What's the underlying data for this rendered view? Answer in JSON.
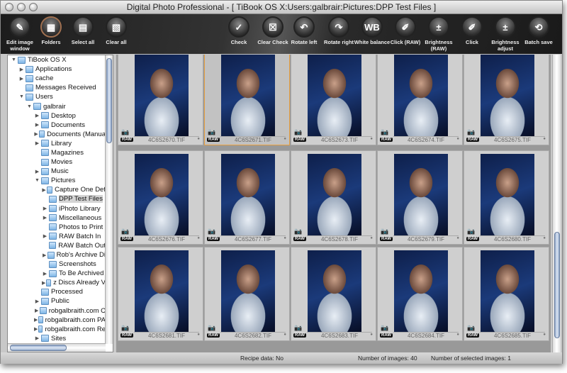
{
  "window": {
    "title": "Digital Photo Professional - [ TiBook OS X:Users:galbrair:Pictures:DPP Test Files ]"
  },
  "toolbar": [
    {
      "label": "Edit image window",
      "icon": "edit-image-icon",
      "glyph": "✎"
    },
    {
      "label": "Folders",
      "icon": "folders-icon",
      "glyph": "▦",
      "active": true
    },
    {
      "label": "Select all",
      "icon": "select-all-icon",
      "glyph": "▤"
    },
    {
      "label": "Clear all",
      "icon": "clear-all-icon",
      "glyph": "▧"
    },
    {
      "label": "Check",
      "icon": "check-icon",
      "glyph": "✓"
    },
    {
      "label": "Clear Check",
      "icon": "clear-check-icon",
      "glyph": "☒"
    },
    {
      "label": "Rotate left",
      "icon": "rotate-left-icon",
      "glyph": "↶"
    },
    {
      "label": "Rotate right",
      "icon": "rotate-right-icon",
      "glyph": "↷"
    },
    {
      "label": "White balance",
      "icon": "white-balance-icon",
      "glyph": "WB"
    },
    {
      "label": "Click (RAW)",
      "icon": "eyedropper-icon",
      "glyph": "✐"
    },
    {
      "label": "Brightness (RAW)",
      "icon": "brightness-icon",
      "glyph": "±"
    },
    {
      "label": "Click",
      "icon": "eyedropper-icon",
      "glyph": "✐"
    },
    {
      "label": "Brightness adjust",
      "icon": "brightness-adjust-icon",
      "glyph": "±"
    },
    {
      "label": "Batch save",
      "icon": "batch-save-icon",
      "glyph": "⟲"
    }
  ],
  "tree": [
    {
      "label": "TiBook OS X",
      "depth": 0,
      "exp": "open"
    },
    {
      "label": "Applications",
      "depth": 1,
      "exp": "closed"
    },
    {
      "label": "cache",
      "depth": 1,
      "exp": "closed"
    },
    {
      "label": "Messages Received",
      "depth": 1,
      "exp": ""
    },
    {
      "label": "Users",
      "depth": 1,
      "exp": "open"
    },
    {
      "label": "galbrair",
      "depth": 2,
      "exp": "open"
    },
    {
      "label": "Desktop",
      "depth": 3,
      "exp": "closed"
    },
    {
      "label": "Documents",
      "depth": 3,
      "exp": "closed"
    },
    {
      "label": "Documents (Manua",
      "depth": 3,
      "exp": "closed"
    },
    {
      "label": "Library",
      "depth": 3,
      "exp": "closed"
    },
    {
      "label": "Magazines",
      "depth": 3,
      "exp": ""
    },
    {
      "label": "Movies",
      "depth": 3,
      "exp": ""
    },
    {
      "label": "Music",
      "depth": 3,
      "exp": "closed"
    },
    {
      "label": "Pictures",
      "depth": 3,
      "exp": "open"
    },
    {
      "label": "Capture One Def",
      "depth": 4,
      "exp": "closed"
    },
    {
      "label": "DPP Test Files",
      "depth": 4,
      "exp": "",
      "selected": true
    },
    {
      "label": "iPhoto Library",
      "depth": 4,
      "exp": "closed"
    },
    {
      "label": "Miscellaneous",
      "depth": 4,
      "exp": "closed"
    },
    {
      "label": "Photos to Print",
      "depth": 4,
      "exp": ""
    },
    {
      "label": "RAW Batch In",
      "depth": 4,
      "exp": "closed"
    },
    {
      "label": "RAW Batch Out",
      "depth": 4,
      "exp": ""
    },
    {
      "label": "Rob's Archive Di",
      "depth": 4,
      "exp": "closed"
    },
    {
      "label": "Screenshots",
      "depth": 4,
      "exp": ""
    },
    {
      "label": "To Be Archived",
      "depth": 4,
      "exp": "closed"
    },
    {
      "label": "z Discs Already V",
      "depth": 4,
      "exp": "closed"
    },
    {
      "label": "Processed",
      "depth": 3,
      "exp": ""
    },
    {
      "label": "Public",
      "depth": 3,
      "exp": "closed"
    },
    {
      "label": "robgalbraith.com C",
      "depth": 3,
      "exp": "closed"
    },
    {
      "label": "robgalbraith.com PA",
      "depth": 3,
      "exp": "closed"
    },
    {
      "label": "robgalbraith.com Re",
      "depth": 3,
      "exp": "closed"
    },
    {
      "label": "Sites",
      "depth": 3,
      "exp": "closed"
    }
  ],
  "thumbnails": [
    {
      "name": "4C6S2670.TIF"
    },
    {
      "name": "4C6S2671.TIF",
      "selected": true
    },
    {
      "name": "4C6S2673.TIF"
    },
    {
      "name": "4C6S2674.TIF"
    },
    {
      "name": "4C6S2675.TIF"
    },
    {
      "name": "4C6S2676.TIF"
    },
    {
      "name": "4C6S2677.TIF"
    },
    {
      "name": "4C6S2678.TIF"
    },
    {
      "name": "4C6S2679.TIF"
    },
    {
      "name": "4C6S2680.TIF"
    },
    {
      "name": "4C6S2681.TIF"
    },
    {
      "name": "4C6S2682.TIF"
    },
    {
      "name": "4C6S2683.TIF"
    },
    {
      "name": "4C6S2684.TIF"
    },
    {
      "name": "4C6S2685.TIF"
    }
  ],
  "badge": "RAW",
  "status": {
    "recipe": "Recipe data: No",
    "count": "Number of images: 40",
    "selected": "Number of selected images: 1"
  },
  "colors": {
    "selection": "#e8a040",
    "toolbar": "#222222"
  }
}
